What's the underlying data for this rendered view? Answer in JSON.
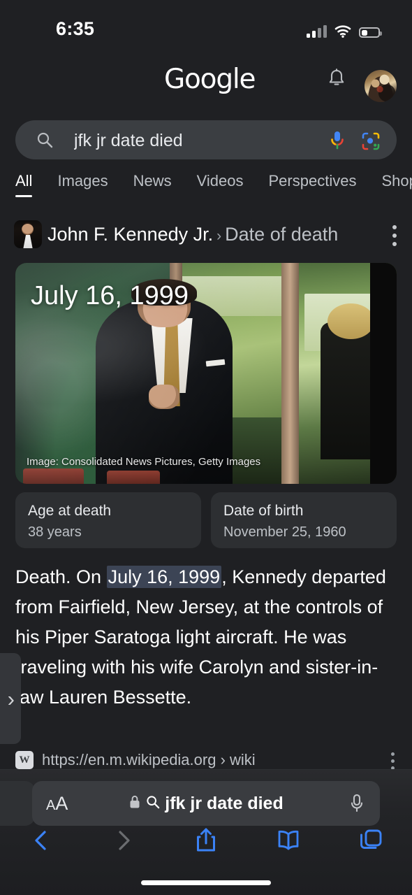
{
  "status_bar": {
    "time": "6:35",
    "cellular_icon": "cellular-bars-icon",
    "cellular_bars_filled": 2,
    "wifi_icon": "wifi-icon",
    "battery_icon": "battery-icon",
    "battery_level_percent": 20
  },
  "header": {
    "logo_text": "Google",
    "notifications_icon": "bell-icon",
    "avatar_icon": "account-avatar"
  },
  "search": {
    "query": "jfk jr date died",
    "search_icon": "magnifier-icon",
    "mic_icon": "microphone-icon",
    "lens_icon": "google-lens-icon"
  },
  "tabs": [
    {
      "label": "All",
      "active": true
    },
    {
      "label": "Images",
      "active": false
    },
    {
      "label": "News",
      "active": false
    },
    {
      "label": "Videos",
      "active": false
    },
    {
      "label": "Perspectives",
      "active": false
    },
    {
      "label": "Shop",
      "active": false
    }
  ],
  "breadcrumb": {
    "thumbnail_icon": "jfk-jr-thumbnail",
    "entity": "John F. Kennedy Jr.",
    "separator": "›",
    "attribute": "Date of death",
    "overflow_icon": "kebab-menu-icon"
  },
  "hero": {
    "date_overlay": "July 16, 1999",
    "credit": "Image: Consolidated News Pictures, Getty Images",
    "photo_alt": "john-f-kennedy-jr-photo"
  },
  "facts": [
    {
      "label": "Age at death",
      "value": "38 years"
    },
    {
      "label": "Date of birth",
      "value": "November 25, 1960"
    }
  ],
  "snippet": {
    "before": "Death. On ",
    "highlight": "July 16, 1999",
    "after": ", Kennedy departed from Fairfield, New Jersey, at the controls of his Piper Saratoga light aircraft. He was traveling with his wife Carolyn and sister-in-law Lauren Bessette."
  },
  "source": {
    "favicon_letter": "W",
    "favicon_icon": "wikipedia-favicon",
    "url": "https://en.m.wikipedia.org › wiki",
    "overflow_icon": "kebab-menu-icon"
  },
  "drawer_handle": {
    "chevron": "›",
    "icon": "expand-drawer-chevron-icon"
  },
  "browser": {
    "reader_label_small": "A",
    "reader_label_large": "A",
    "reader_icon": "text-size-icon",
    "lock_icon": "lock-icon",
    "search_icon": "magnifier-icon",
    "url_text": "jfk jr date died",
    "mic_icon": "microphone-icon",
    "nav": [
      {
        "name": "back",
        "icon": "chevron-left-icon",
        "enabled": true
      },
      {
        "name": "forward",
        "icon": "chevron-right-icon",
        "enabled": false
      },
      {
        "name": "share",
        "icon": "share-icon",
        "enabled": true
      },
      {
        "name": "bookmarks",
        "icon": "book-icon",
        "enabled": true
      },
      {
        "name": "tabs",
        "icon": "tabs-icon",
        "enabled": true
      }
    ],
    "accent_color": "#3b82f6",
    "disabled_color": "#6b6d70"
  }
}
